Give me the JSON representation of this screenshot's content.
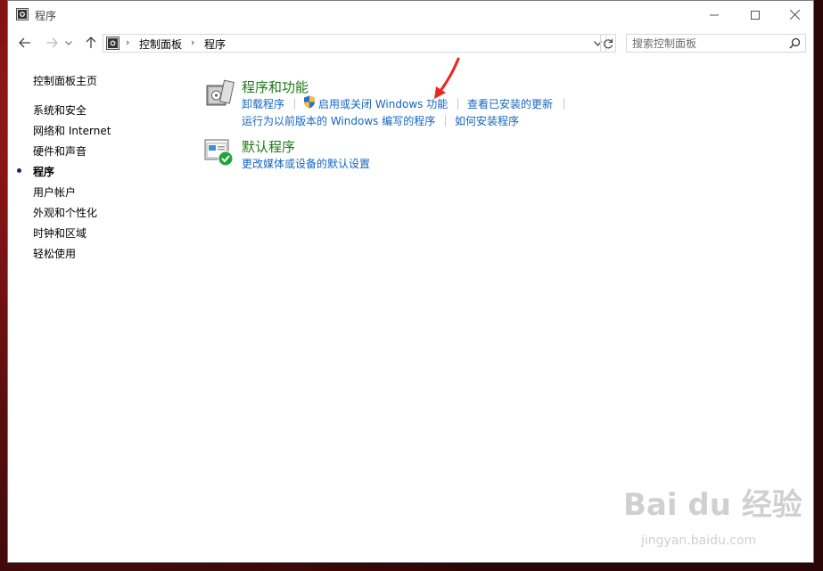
{
  "window": {
    "title": "程序",
    "minimize_icon": "minimize-icon",
    "maximize_icon": "maximize-icon",
    "close_icon": "close-icon"
  },
  "navbar": {
    "back_icon": "arrow-left-icon",
    "forward_icon": "arrow-right-icon",
    "recent_icon": "chevron-down-icon",
    "up_icon": "arrow-up-icon",
    "breadcrumb": [
      "控制面板",
      "程序"
    ],
    "refresh_icon": "refresh-icon",
    "search_placeholder": "搜索控制面板"
  },
  "leftnav": {
    "home": "控制面板主页",
    "items": [
      "系统和安全",
      "网络和 Internet",
      "硬件和声音",
      "程序",
      "用户帐户",
      "外观和个性化",
      "时钟和区域",
      "轻松使用"
    ],
    "active_index": 3
  },
  "categories": [
    {
      "title": "程序和功能",
      "icon": "programs-features-icon",
      "links_row1": [
        "卸载程序",
        "启用或关闭 Windows 功能",
        "查看已安装的更新"
      ],
      "links_row2": [
        "运行为以前版本的 Windows 编写的程序",
        "如何安装程序"
      ]
    },
    {
      "title": "默认程序",
      "icon": "default-programs-icon",
      "links_row1": [
        "更改媒体或设备的默认设置"
      ]
    }
  ],
  "watermark": {
    "main": "Bai du 经验",
    "sub": "jingyan.baidu.com"
  },
  "colors": {
    "category_title": "#1e7a14",
    "link": "#1465c0",
    "annotation_arrow": "#e8281e"
  }
}
